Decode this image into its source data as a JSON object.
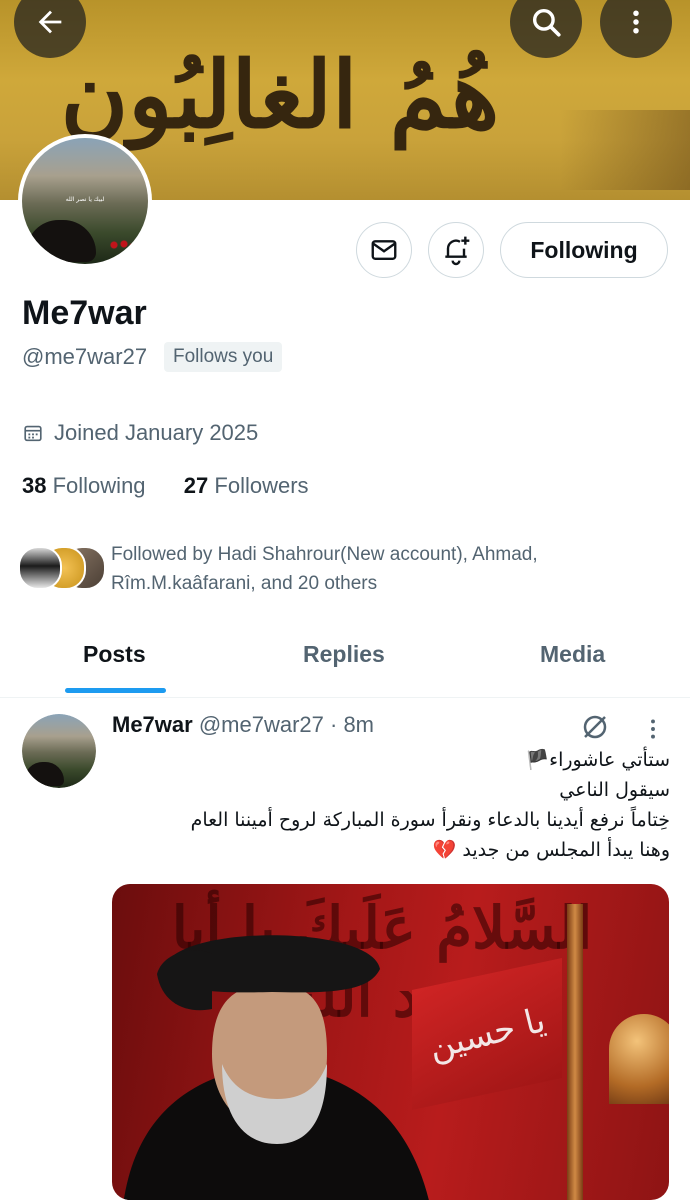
{
  "banner": {
    "calligraphy": "هُمُ الغالِبُون"
  },
  "profile": {
    "name": "Me7war",
    "handle": "@me7war27",
    "follows_you": "Follows you",
    "joined": "Joined January 2025",
    "following_count": "38",
    "following_label": "Following",
    "followers_count": "27",
    "followers_label": "Followers",
    "follow_button": "Following",
    "avatar_caption": "لبيك يا نصر الله",
    "mutual_line1": "Followed by Hadi Shahrour(New account), Ahmad,",
    "mutual_line2": "Rîm.M.kaâfarani, and 20 others"
  },
  "tabs": [
    {
      "label": "Posts"
    },
    {
      "label": "Replies"
    },
    {
      "label": "Media"
    }
  ],
  "post": {
    "name": "Me7war",
    "handle_time": "@me7war27 · 8m",
    "lines": [
      "ستأتي عاشوراء🏴",
      "سيقول الناعي",
      "خِتاماً نرفع أيدينا بالدعاء ونقرأ سورة المباركة لروح أميننا العام",
      "وهنا يبدأ المجلس من جديد 💔"
    ],
    "image_text_arabic": "السَّلامُ عَلَيكَ يا أبا عبد الله",
    "image_flag_text": "يا حسين"
  },
  "colors": {
    "accent": "#1d9bf0",
    "text": "#0f1419",
    "secondary": "#536471",
    "border": "#cfd9de"
  }
}
